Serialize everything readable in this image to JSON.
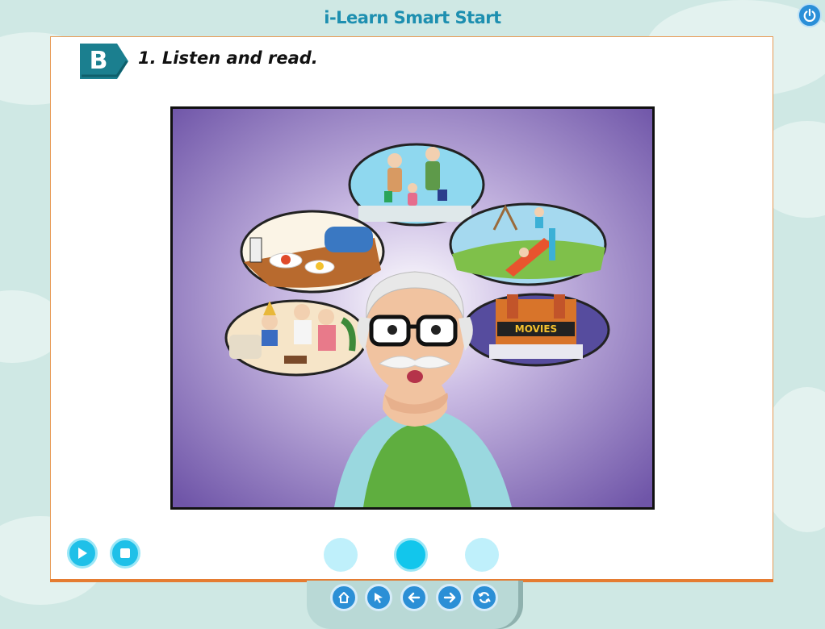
{
  "app": {
    "title": "i-Learn Smart Start"
  },
  "section": {
    "letter": "B",
    "instruction": "1. Listen and read."
  },
  "illustration": {
    "bubbles": [
      "grandparents-with-grandchild",
      "cooking-food",
      "playground",
      "movies-theater",
      "birthday-party"
    ],
    "movies_sign": "MOVIES"
  },
  "player": {
    "play_icon": "play-icon",
    "stop_icon": "stop-icon"
  },
  "pagination": {
    "total": 3,
    "active": 2
  },
  "nav": {
    "icons": [
      "home-icon",
      "pointer-icon",
      "back-icon",
      "forward-icon",
      "refresh-icon"
    ]
  },
  "colors": {
    "accent": "#1fc0e8",
    "panel_border": "#e57c32",
    "badge": "#1b7f8f",
    "title": "#1d8fb0",
    "bg": "#cfe8e4"
  }
}
